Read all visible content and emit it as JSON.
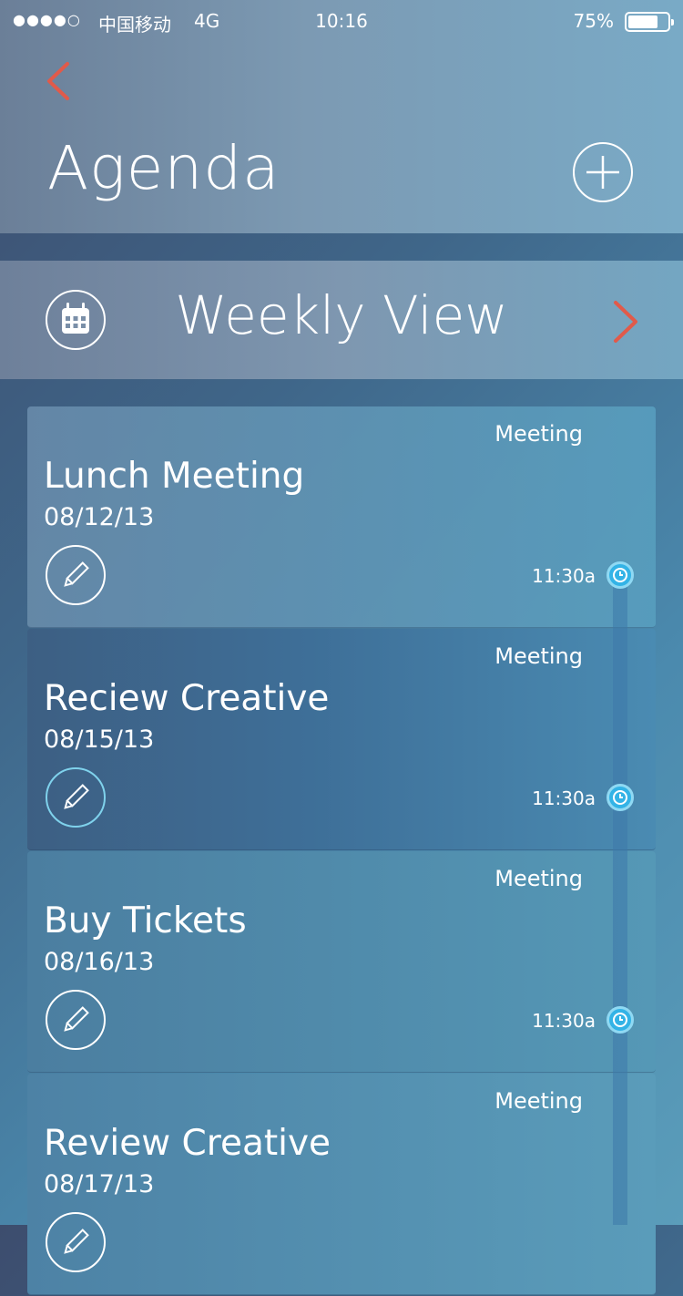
{
  "status_bar": {
    "signal": "●●●●○",
    "carrier": "中国移动",
    "network": "4G",
    "time": "10:16",
    "battery": "75%"
  },
  "header": {
    "title": "Agenda"
  },
  "weekly": {
    "label": "Weekly View"
  },
  "agenda": [
    {
      "tag": "Meeting",
      "title": "Lunch Meeting",
      "date": "08/12/13",
      "time": "11:30a"
    },
    {
      "tag": "Meeting",
      "title": "Reciew Creative",
      "date": "08/15/13",
      "time": "11:30a"
    },
    {
      "tag": "Meeting",
      "title": "Buy Tickets",
      "date": "08/16/13",
      "time": "11:30a"
    },
    {
      "tag": "Meeting",
      "title": "Review Creative",
      "date": "08/17/13"
    }
  ],
  "colors": {
    "accent": "#e15a4a",
    "clock": "#33b3e6"
  }
}
